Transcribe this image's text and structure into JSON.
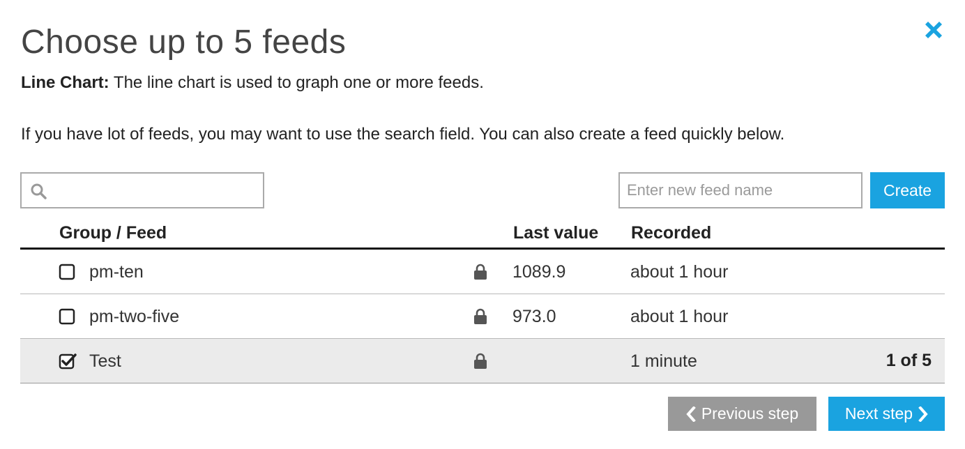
{
  "dialog": {
    "title": "Choose up to 5 feeds",
    "description_label": "Line Chart:",
    "description_text": " The line chart is used to graph one or more feeds.",
    "hint": "If you have lot of feeds, you may want to use the search field. You can also create a feed quickly below.",
    "close_icon": "close-icon"
  },
  "search": {
    "value": "",
    "placeholder": "",
    "icon": "search-icon"
  },
  "new_feed": {
    "placeholder": "Enter new feed name",
    "create_label": "Create"
  },
  "table": {
    "headers": {
      "feed": "Group / Feed",
      "last_value": "Last value",
      "recorded": "Recorded"
    },
    "rows": [
      {
        "name": "pm-ten",
        "checked": false,
        "locked": true,
        "last_value": "1089.9",
        "recorded": "about 1 hour",
        "count": ""
      },
      {
        "name": "pm-two-five",
        "checked": false,
        "locked": true,
        "last_value": "973.0",
        "recorded": "about 1 hour",
        "count": ""
      },
      {
        "name": "Test",
        "checked": true,
        "locked": true,
        "last_value": "",
        "recorded": "1 minute",
        "count": "1 of 5"
      }
    ]
  },
  "footer": {
    "previous_label": "Previous step",
    "next_label": "Next step"
  },
  "colors": {
    "accent": "#1aa3e0",
    "secondary_button": "#999999",
    "selected_row": "#ebebeb"
  }
}
